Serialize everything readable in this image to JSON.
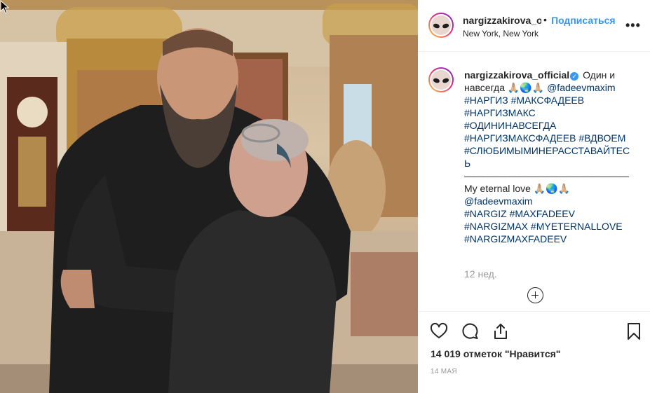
{
  "header": {
    "username": "nargizzakirova_official",
    "separator": "•",
    "follow_label": "Подписаться",
    "location": "New York, New York",
    "more_label": "•••"
  },
  "caption": {
    "username": "nargizzakirova_official",
    "verified_mark": "✓",
    "text_ru": "Один и навсегда 🙏🏼🌏🙏🏼",
    "mention_1": "@fadeevmaxim",
    "hashtags_ru": [
      "#НАРГИЗ",
      "#МАКСФАДЕЕВ",
      "#НАРГИЗМАКС",
      "#ОДИНИНАВСЕГДА",
      "#НАРГИЗМАКСФАДЕЕВ",
      "#ВДВОЕМ",
      "#СЛЮБИМЫМИНЕРАССТАВАЙТЕСЬ"
    ],
    "rule": "——————————————————",
    "text_en": "My eternal love 🙏🏼🌏🙏🏼",
    "mention_2": "@fadeevmaxim",
    "hashtags_en": [
      "#NARGIZ",
      "#MAXFADEEV",
      "#NARGIZMAX",
      "#MYETERNALLOVE",
      "#NARGIZMAXFADEEV"
    ],
    "time_ago": "12 нед."
  },
  "actions": {
    "like_icon": "heart-outline-icon",
    "comment_icon": "comment-bubble-icon",
    "share_icon": "share-upload-icon",
    "save_icon": "bookmark-icon",
    "likes_text": "14 019 отметок \"Нравится\"",
    "date": "14 МАЯ"
  },
  "colors": {
    "accent": "#3897f0",
    "hashtag": "#003569",
    "muted": "#999999",
    "border": "#efefef"
  }
}
